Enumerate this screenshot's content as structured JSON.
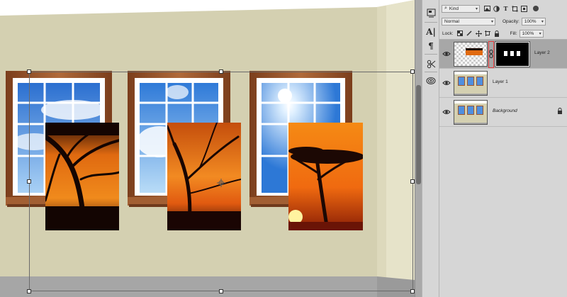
{
  "layers_panel": {
    "filter_kind": "Kind",
    "blend_mode": "Normal",
    "opacity_label": "Opacity:",
    "opacity_value": "100%",
    "lock_label": "Lock:",
    "fill_label": "Fill:",
    "fill_value": "100%",
    "layers": [
      {
        "name": "Layer 2",
        "selected": true,
        "visible": true,
        "has_mask": true
      },
      {
        "name": "Layer 1",
        "selected": false,
        "visible": true
      },
      {
        "name": "Background",
        "selected": false,
        "visible": true,
        "locked": true
      }
    ]
  },
  "toolstrip": {
    "items": [
      "panel-icon",
      "character-icon",
      "paragraph-icon",
      "tools-preset-icon",
      "3d-icon"
    ],
    "character_glyph": "A|",
    "paragraph_glyph": "¶"
  },
  "colors": {
    "panel_bg": "#d6d6d6",
    "selected_layer": "#a7a7a7",
    "mask_link_highlight": "#e0383a",
    "wall": "#d4d0b1",
    "window_frame": "#9a5630",
    "sunset_orange": "#f07a14"
  }
}
